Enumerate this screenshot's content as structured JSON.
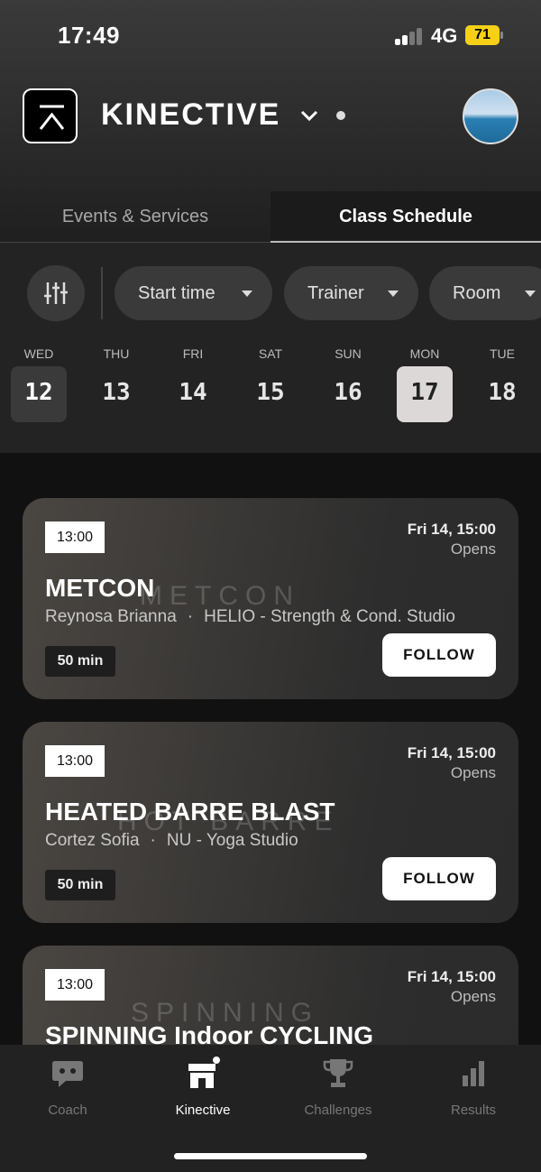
{
  "status_bar": {
    "time": "17:49",
    "network": "4G",
    "battery": "71"
  },
  "header": {
    "brand": "KINECTIVE",
    "logo_icon": "kinective-logo-icon",
    "avatar_icon": "avatar"
  },
  "tabs": [
    {
      "label": "Events & Services",
      "active": false
    },
    {
      "label": "Class Schedule",
      "active": true
    }
  ],
  "filters": {
    "start_time": "Start time",
    "trainer": "Trainer",
    "room": "Room"
  },
  "days": [
    {
      "name": "WED",
      "num": "12",
      "state": "active"
    },
    {
      "name": "THU",
      "num": "13",
      "state": ""
    },
    {
      "name": "FRI",
      "num": "14",
      "state": ""
    },
    {
      "name": "SAT",
      "num": "15",
      "state": ""
    },
    {
      "name": "SUN",
      "num": "16",
      "state": ""
    },
    {
      "name": "MON",
      "num": "17",
      "state": "selected"
    },
    {
      "name": "TUE",
      "num": "18",
      "state": ""
    }
  ],
  "classes": [
    {
      "time": "13:00",
      "opens_date": "Fri 14, 15:00",
      "opens_label": "Opens",
      "title": "METCON",
      "bg_word": "METCON",
      "trainer": "Reynosa Brianna",
      "studio": "HELIO - Strength & Cond. Studio",
      "duration": "50 min",
      "action": "FOLLOW"
    },
    {
      "time": "13:00",
      "opens_date": "Fri 14, 15:00",
      "opens_label": "Opens",
      "title": "HEATED BARRE BLAST",
      "bg_word": "HOT BARRE",
      "trainer": "Cortez Sofia",
      "studio": "NU - Yoga Studio",
      "duration": "50 min",
      "action": "FOLLOW"
    },
    {
      "time": "13:00",
      "opens_date": "Fri 14, 15:00",
      "opens_label": "Opens",
      "title": "SPINNING Indoor CYCLING",
      "bg_word": "SPINNING",
      "trainer": "",
      "studio": "",
      "duration": "",
      "action": ""
    }
  ],
  "bottom_nav": [
    {
      "label": "Coach",
      "icon": "chat-bubble-icon",
      "active": false
    },
    {
      "label": "Kinective",
      "icon": "store-icon",
      "active": true
    },
    {
      "label": "Challenges",
      "icon": "trophy-icon",
      "active": false
    },
    {
      "label": "Results",
      "icon": "bar-chart-icon",
      "active": false
    }
  ],
  "colors": {
    "background": "#111111",
    "card": "#2d2d2d",
    "selected_day": "#ddd8d8",
    "battery": "#f5d016"
  }
}
